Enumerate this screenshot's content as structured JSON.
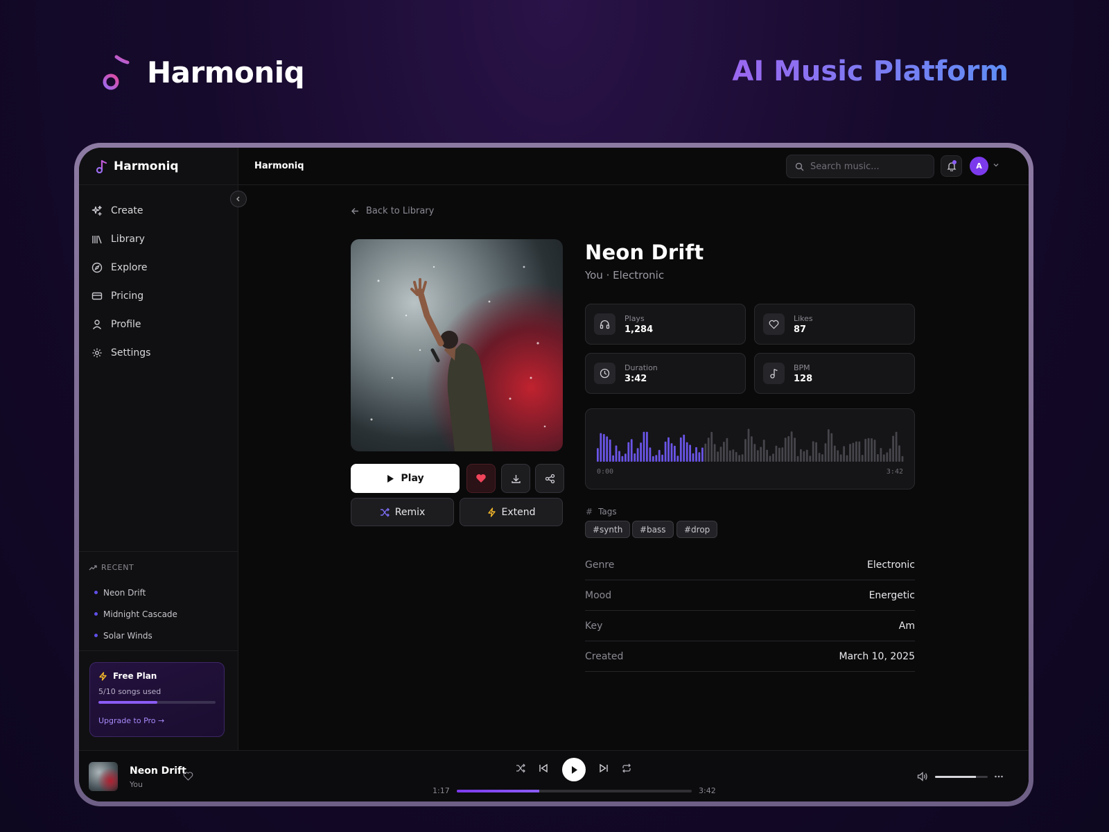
{
  "hero": {
    "title": "Harmoniq",
    "tagline": "AI Music Platform"
  },
  "sidebar": {
    "brand": "Harmoniq",
    "nav": [
      {
        "label": "Create",
        "icon": "sparkle-icon"
      },
      {
        "label": "Library",
        "icon": "library-icon"
      },
      {
        "label": "Explore",
        "icon": "compass-icon"
      },
      {
        "label": "Pricing",
        "icon": "credit-card-icon"
      },
      {
        "label": "Profile",
        "icon": "user-icon"
      },
      {
        "label": "Settings",
        "icon": "gear-icon"
      }
    ],
    "recent_heading": "RECENT",
    "recent": [
      "Neon Drift",
      "Midnight Cascade",
      "Solar Winds"
    ],
    "plan": {
      "title": "Free Plan",
      "usage": "5/10 songs used",
      "used": 5,
      "limit": 10,
      "link": "Upgrade to Pro →"
    }
  },
  "topbar": {
    "title": "Harmoniq",
    "search_placeholder": "Search music...",
    "avatar": "A"
  },
  "main": {
    "back_label": "Back to Library",
    "play_label": "Play",
    "remix_label": "Remix",
    "extend_label": "Extend",
    "song": {
      "title": "Neon Drift",
      "subtitle": "You · Electronic"
    },
    "stats": [
      {
        "label": "Plays",
        "value": "1,284",
        "icon": "headphones-icon"
      },
      {
        "label": "Likes",
        "value": "87",
        "icon": "heart-icon"
      },
      {
        "label": "Duration",
        "value": "3:42",
        "icon": "clock-icon"
      },
      {
        "label": "BPM",
        "value": "128",
        "icon": "music-note-icon"
      }
    ],
    "waveform": {
      "start": "0:00",
      "end": "3:42",
      "progress": 0.35,
      "played_color": "#6a55e8",
      "unplayed_color": "#45454b"
    },
    "tags_label": "Tags",
    "tags": [
      "#synth",
      "#bass",
      "#drop"
    ],
    "meta": [
      {
        "key": "Genre",
        "value": "Electronic"
      },
      {
        "key": "Mood",
        "value": "Energetic"
      },
      {
        "key": "Key",
        "value": "Am"
      },
      {
        "key": "Created",
        "value": "March 10, 2025"
      }
    ]
  },
  "player": {
    "title": "Neon Drift",
    "artist": "You",
    "current": "1:17",
    "total": "3:42",
    "progress": 0.35,
    "volume": 0.78
  },
  "colors": {
    "accent": "#8b5cf6",
    "like": "#f0445a",
    "bolt": "#f5b82a"
  }
}
